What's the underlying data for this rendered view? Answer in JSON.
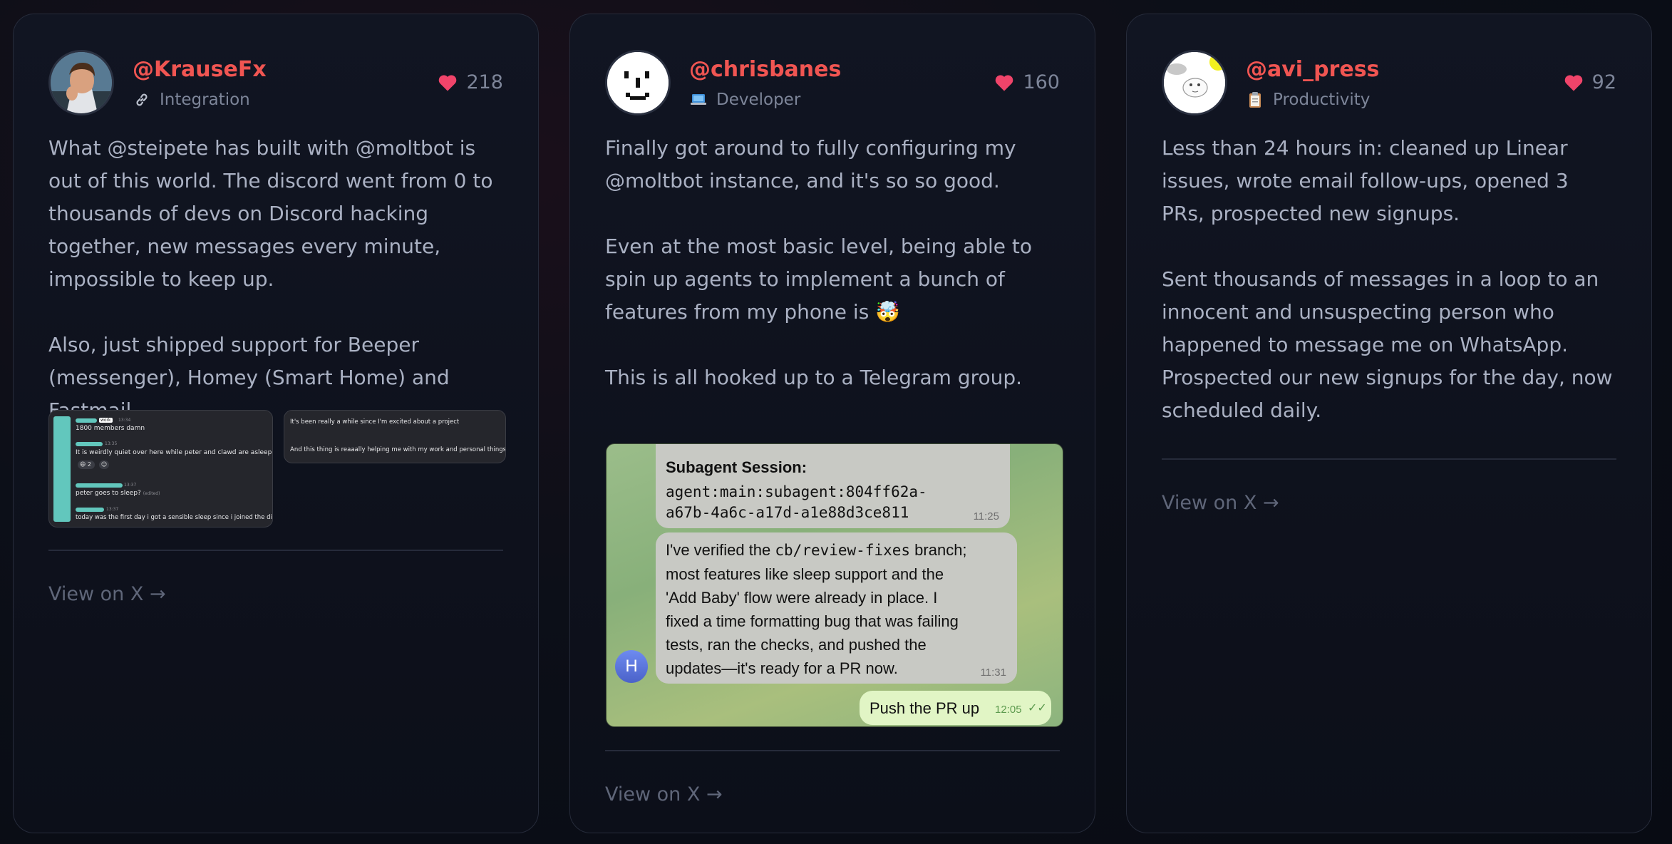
{
  "cards": [
    {
      "handle": "@KrauseFx",
      "category": "Integration",
      "category_icon": "link-icon",
      "likes": "218",
      "paragraphs": [
        "What @steipete has built with @moltbot is out of this world. The discord went from 0 to thousands of devs on Discord hacking together, new messages every minute, impossible to keep up.",
        "Also, just shipped support for Beeper (messenger), Homey (Smart Home) and Fastmail"
      ],
      "shot1": {
        "tag": "work",
        "t1": "13:34",
        "m1": "1800 members damn",
        "t2": "13:35",
        "m2": "It is weirdly quiet over here while peter and clawd are asleep",
        "r1": "2",
        "t3": "13:37",
        "m3": "peter goes to sleep?",
        "m3b": "(edited)",
        "t4": "13:37",
        "m4": "today was the first day i got a sensible sleep since i joined the discord. lol"
      },
      "shot2": {
        "m1": "It's been really a while since I'm excited about a project",
        "m2": "And this thing is reaaally helping me with my work and personal things."
      },
      "view_link": "View on X →"
    },
    {
      "handle": "@chrisbanes",
      "category": "Developer",
      "category_icon": "laptop-icon",
      "likes": "160",
      "paragraphs": [
        "Finally got around to fully configuring my @moltbot instance, and it's so so good.",
        "Even at the most basic level, being able to spin up agents to implement a bunch of features from my phone is 🤯",
        "This is all hooked up to a Telegram group."
      ],
      "telegram": {
        "b1_title": "Subagent Session:",
        "b1_code1": "agent:main:subagent:804ff62a-",
        "b1_code2": "a67b-4a6c-a17d-a1e88d3ce811",
        "b1_time": "11:25",
        "b2_pre": "I've verified the ",
        "b2_code": "cb/review-fixes",
        "b2_post": " branch;",
        "b2_l2": "most features like sleep support and the",
        "b2_l3": "'Add Baby' flow were already in place. I",
        "b2_l4": "fixed a time formatting bug that was failing",
        "b2_l5": "tests, ran the checks, and pushed the",
        "b2_l6": "updates—it's ready for a PR now.",
        "b2_time": "11:31",
        "avatar_letter": "H",
        "b3_text": "Push the PR up",
        "b3_time": "12:05"
      },
      "view_link": "View on X →"
    },
    {
      "handle": "@avi_press",
      "category": "Productivity",
      "category_icon": "clipboard-icon",
      "likes": "92",
      "paragraphs": [
        "Less than 24 hours in: cleaned up Linear issues, wrote email follow-ups, opened 3 PRs, prospected new signups.",
        "Sent thousands of messages in a loop to an innocent and unsuspecting person who happened to message me on WhatsApp.",
        "Prospected our new signups for the day, now scheduled daily."
      ],
      "view_link": "View on X →"
    }
  ],
  "colors": {
    "handle": "#f05552",
    "heart": "#f0446a",
    "background": "#0c0f18",
    "discord_name": "#62c7bd"
  }
}
